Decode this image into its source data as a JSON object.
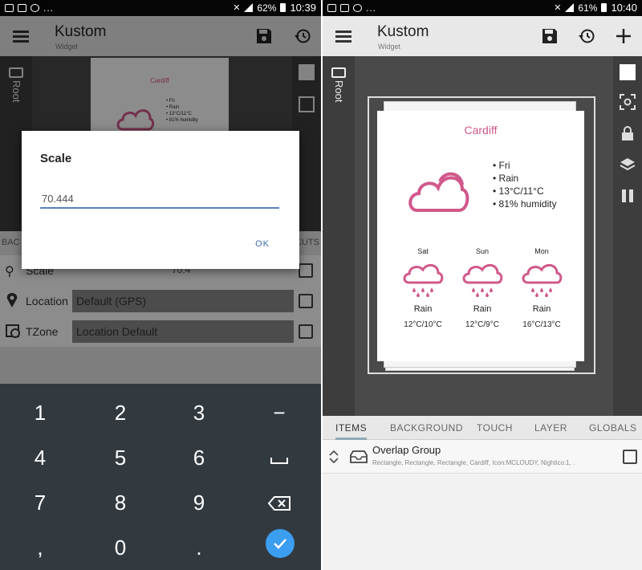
{
  "status_left": {
    "time": "10:39",
    "battery": "62%"
  },
  "status_right": {
    "time": "10:40",
    "battery": "61%"
  },
  "app": {
    "title": "Kustom",
    "subtitle": "Widget",
    "root_label": "Root"
  },
  "widget": {
    "city": "Cardiff",
    "bullets": [
      "• Fri",
      "• Rain",
      "• 13°C/11°C",
      "• 81% humidity"
    ],
    "forecast": [
      {
        "day": "Sat",
        "cond": "Rain",
        "temp": "12°C/10°C"
      },
      {
        "day": "Sun",
        "cond": "Rain",
        "temp": "12°C/9°C"
      },
      {
        "day": "Mon",
        "cond": "Rain",
        "temp": "16°C/13°C"
      }
    ]
  },
  "left_tabs_partial": {
    "back": "BAC",
    "cuts": "CUTS"
  },
  "left_rows": [
    {
      "label": "Scale",
      "value": "70.4"
    },
    {
      "label": "Location",
      "value": "Default (GPS)"
    },
    {
      "label": "TZone",
      "value": "Location Default"
    }
  ],
  "dialog": {
    "title": "Scale",
    "value": "70.444",
    "ok": "OK"
  },
  "keyboard": {
    "rows": [
      [
        "1",
        "2",
        "3",
        "−"
      ],
      [
        "4",
        "5",
        "6",
        "␣"
      ],
      [
        "7",
        "8",
        "9",
        "⌫"
      ],
      [
        ",",
        "0",
        ".",
        "✓"
      ]
    ]
  },
  "tabs": [
    "ITEMS",
    "BACKGROUND",
    "TOUCH",
    "LAYER",
    "GLOBALS"
  ],
  "item": {
    "title": "Overlap Group",
    "subtitle": "Rectangle, Rectangle, Rectangle, Cardiff, Icon:MCLOUDY, Nightico:1, ."
  },
  "colors": {
    "accent_pink": "#d1588b",
    "keyboard_bg": "#323a40",
    "check_blue": "#3c9ef0"
  }
}
